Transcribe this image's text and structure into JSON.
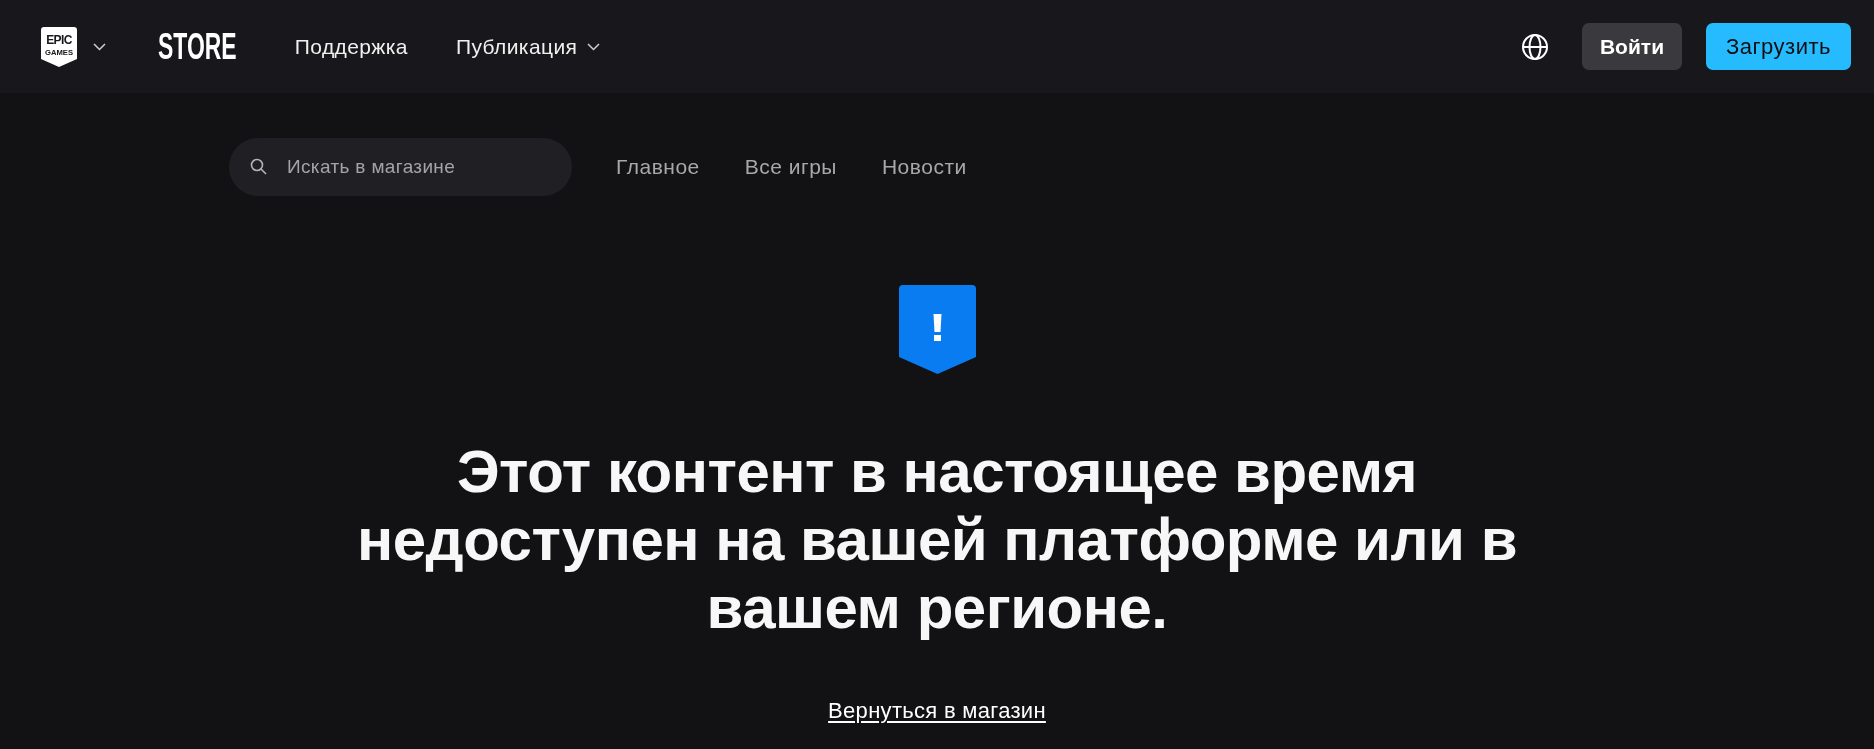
{
  "header": {
    "logo": {
      "line_1": "EPIC",
      "line_2": "GAMES"
    },
    "brand": "STORE",
    "nav": [
      {
        "label": "Поддержка",
        "kind": "link"
      },
      {
        "label": "Публикация",
        "kind": "dropdown"
      }
    ],
    "sign_in": "Войти",
    "download": "Загрузить"
  },
  "store_nav": {
    "search": {
      "placeholder": "Искать в магазине"
    },
    "links": [
      {
        "label": "Главное"
      },
      {
        "label": "Все игры"
      },
      {
        "label": "Новости"
      }
    ]
  },
  "message": {
    "title": "Этот контент в настоящее время недоступен на вашей платформе или в вашем регионе.",
    "link": "Вернуться в магазин"
  }
}
